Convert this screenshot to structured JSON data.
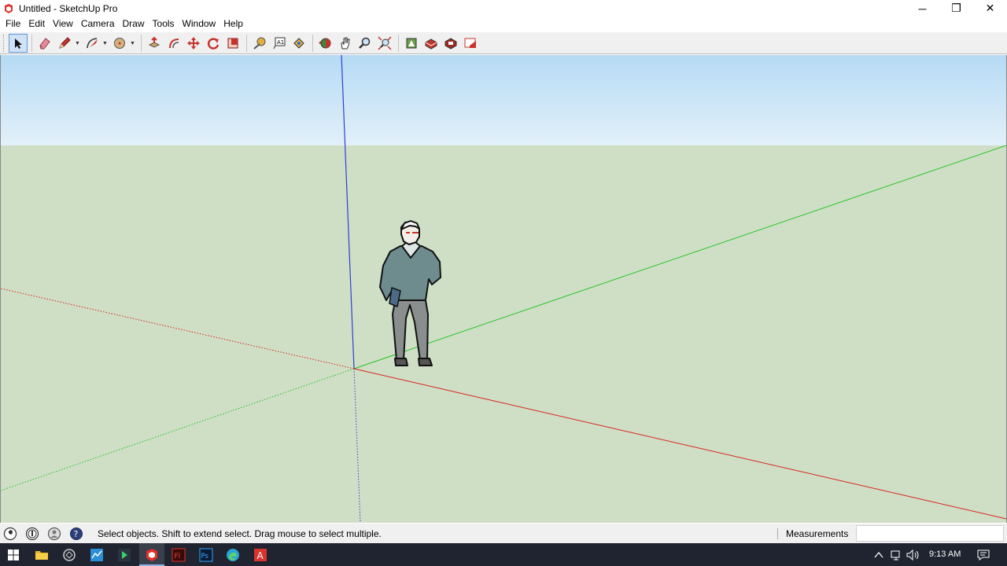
{
  "window": {
    "title": "Untitled - SketchUp Pro",
    "controls": {
      "minimize": "─",
      "restore": "❐",
      "close": "✕"
    }
  },
  "menu": [
    "File",
    "Edit",
    "View",
    "Camera",
    "Draw",
    "Tools",
    "Window",
    "Help"
  ],
  "toolbar": {
    "tools": [
      {
        "name": "select",
        "icon": "select-arrow-icon",
        "active": true
      },
      {
        "name": "eraser",
        "icon": "eraser-icon"
      },
      {
        "name": "line",
        "icon": "pencil-icon",
        "dropdown": true
      },
      {
        "name": "arc",
        "icon": "arc-icon",
        "dropdown": true
      },
      {
        "name": "shapes",
        "icon": "circle-shape-icon",
        "dropdown": true
      },
      {
        "name": "push-pull",
        "icon": "push-pull-icon"
      },
      {
        "name": "offset",
        "icon": "offset-icon"
      },
      {
        "name": "move",
        "icon": "move-icon"
      },
      {
        "name": "rotate",
        "icon": "rotate-icon"
      },
      {
        "name": "scale",
        "icon": "scale-icon"
      },
      {
        "name": "tape-measure",
        "icon": "tape-measure-icon"
      },
      {
        "name": "text",
        "icon": "text-icon"
      },
      {
        "name": "paint-bucket",
        "icon": "paint-bucket-icon"
      },
      {
        "name": "orbit",
        "icon": "orbit-icon"
      },
      {
        "name": "pan",
        "icon": "pan-hand-icon"
      },
      {
        "name": "zoom",
        "icon": "zoom-icon"
      },
      {
        "name": "zoom-extents",
        "icon": "zoom-extents-icon"
      },
      {
        "name": "3d-warehouse",
        "icon": "warehouse-icon"
      },
      {
        "name": "extension-warehouse",
        "icon": "extension-warehouse-icon"
      },
      {
        "name": "extension-manager",
        "icon": "extension-manager-icon"
      },
      {
        "name": "layout",
        "icon": "layout-icon"
      }
    ],
    "accent": "#5c9ad6"
  },
  "viewport": {
    "sky_color": "#c9e3f5",
    "ground_color": "#cfdfc6",
    "axis_colors": {
      "red": "#d9241c",
      "green": "#22c322",
      "blue": "#2b3fd4"
    }
  },
  "status": {
    "icons": [
      "geo-location-icon",
      "credits-icon",
      "user-icon",
      "help-icon"
    ],
    "message": "Select objects. Shift to extend select. Drag mouse to select multiple.",
    "measurements_label": "Measurements",
    "measurements_value": ""
  },
  "taskbar": {
    "time": "9:13 AM",
    "apps": [
      "start-icon",
      "file-explorer-icon",
      "app-circle-icon",
      "app-chart-icon",
      "app-play-icon",
      "sketchup-icon",
      "flash-icon",
      "photoshop-icon",
      "edge-icon",
      "acrobat-icon"
    ],
    "app_labels": {
      "flash": "Fl",
      "photoshop": "Ps",
      "acrobat": "A"
    }
  }
}
